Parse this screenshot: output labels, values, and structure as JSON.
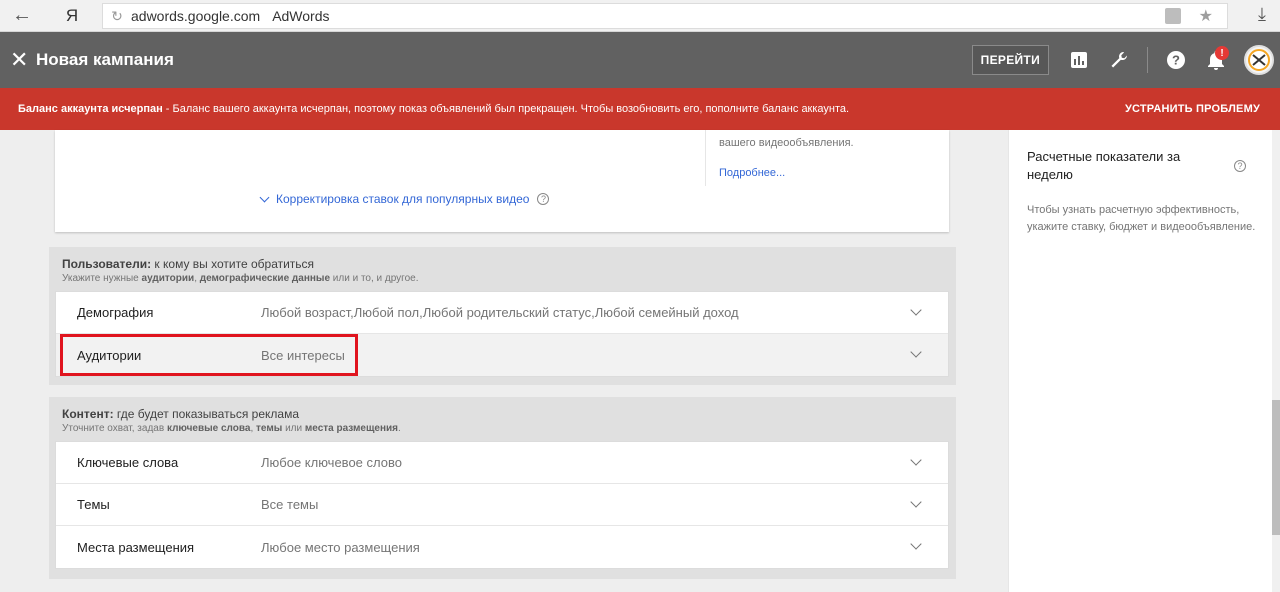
{
  "browser": {
    "ya_logo": "Я",
    "url": "adwords.google.com",
    "tab_title": "AdWords"
  },
  "header": {
    "title": "Новая кампания",
    "go_button": "ПЕРЕЙТИ",
    "notification_badge": "!",
    "icons": [
      "close-icon",
      "bar-chart-icon",
      "wrench-icon",
      "help-icon",
      "bell-icon",
      "avatar"
    ]
  },
  "alert": {
    "bold_text": "Баланс аккаунта исчерпан",
    "text": " - Баланс вашего аккаунта исчерпан, поэтому показ объявлений был прекращен. Чтобы возобновить его, пополните баланс аккаунта.",
    "fix_button": "УСТРАНИТЬ ПРОБЛЕМУ",
    "color": "#c9372c"
  },
  "top_card": {
    "snippet": "вашего видеообъявления.",
    "more_link": "Подробнее...",
    "adjust_link": "Корректировка ставок для популярных видео"
  },
  "users_section": {
    "heading_bold": "Пользователи:",
    "heading_rest": " к кому вы хотите обратиться",
    "sub_1": "Укажите нужные ",
    "sub_b1": "аудитории",
    "sub_2": ", ",
    "sub_b2": "демографические данные",
    "sub_3": " или и то, и другое.",
    "rows": [
      {
        "label": "Демография",
        "value": "Любой возраст,Любой пол,Любой родительский статус,Любой семейный доход"
      },
      {
        "label": "Аудитории",
        "value": "Все интересы"
      }
    ]
  },
  "content_section": {
    "heading_bold": "Контент:",
    "heading_rest": " где будет показываться реклама",
    "sub_1": "Уточните охват, задав ",
    "sub_b1": "ключевые слова",
    "sub_2": ", ",
    "sub_b2": "темы",
    "sub_3": " или ",
    "sub_b3": "места размещения",
    "sub_4": ".",
    "rows": [
      {
        "label": "Ключевые слова",
        "value": "Любое ключевое слово"
      },
      {
        "label": "Темы",
        "value": "Все темы"
      },
      {
        "label": "Места размещения",
        "value": "Любое место размещения"
      }
    ]
  },
  "side_panel": {
    "title": "Расчетные показатели за неделю",
    "text": "Чтобы узнать расчетную эффективность, укажите ставку, бюджет и видеообъявление."
  }
}
